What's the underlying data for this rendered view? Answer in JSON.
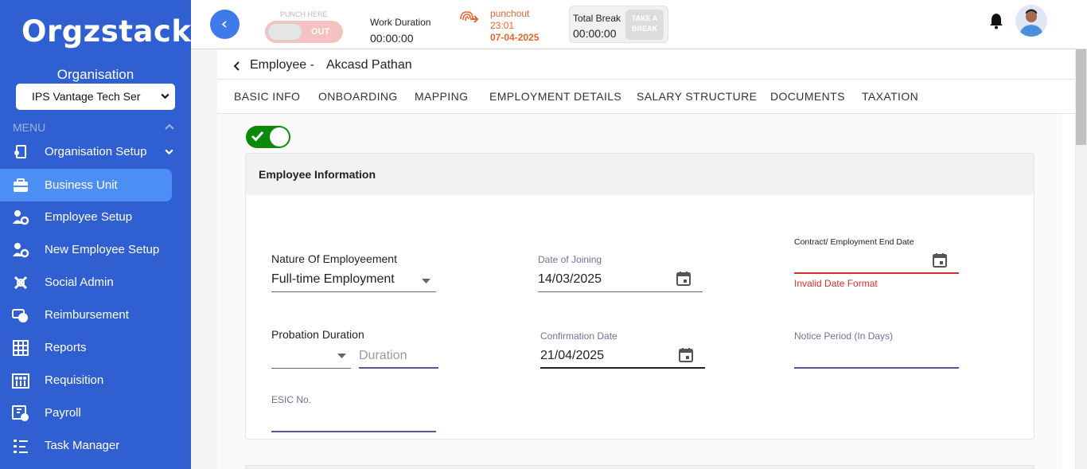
{
  "app": {
    "logo": "Orgzstack"
  },
  "sidebar": {
    "org_label": "Organisation",
    "org_select_value": "IPS Vantage Tech Ser",
    "menu_label": "MENU",
    "items": [
      {
        "label": "Organisation Setup",
        "icon": "org-setup-icon"
      },
      {
        "label": "Business Unit",
        "icon": "briefcase-icon"
      },
      {
        "label": "Employee Setup",
        "icon": "users-gear-icon"
      },
      {
        "label": "New Employee Setup",
        "icon": "users-gear-icon"
      },
      {
        "label": "Social Admin",
        "icon": "social-icon"
      },
      {
        "label": "Reimbursement",
        "icon": "money-icon"
      },
      {
        "label": "Reports",
        "icon": "grid-icon"
      },
      {
        "label": "Requisition",
        "icon": "people-icon"
      },
      {
        "label": "Payroll",
        "icon": "payroll-icon"
      },
      {
        "label": "Task Manager",
        "icon": "list-icon"
      }
    ]
  },
  "topbar": {
    "punch_here": "PUNCH HERE",
    "punch_toggle_label": "OUT",
    "work_duration_label": "Work Duration",
    "work_duration_value": "00:00:00",
    "punchout_label": "punchout",
    "punchout_time": "23:01",
    "punchout_date": "07-04-2025",
    "total_break_label": "Total Break",
    "total_break_value": "00:00:00",
    "take_break_label": "TAKE A BREAK"
  },
  "breadcrumb": {
    "title": "Employee -",
    "name": "Akcasd Pathan"
  },
  "tabs": [
    "BASIC INFO",
    "ONBOARDING",
    "MAPPING",
    "EMPLOYMENT DETAILS",
    "SALARY STRUCTURE",
    "DOCUMENTS",
    "TAXATION"
  ],
  "status_toggle_on": true,
  "card": {
    "title": "Employee Information",
    "nature_label": "Nature Of Employeement",
    "nature_value": "Full-time Employment",
    "doj_label": "Date of Joining",
    "doj_value": "14/03/2025",
    "end_date_label": "Contract/ Employment End Date",
    "end_date_error": "Invalid Date Format",
    "probation_label": "Probation Duration",
    "probation_placeholder": "Duration",
    "confirmation_label": "Confirmation Date",
    "confirmation_value": "21/04/2025",
    "notice_label": "Notice Period (In Days)",
    "esic_label": "ESIC No."
  },
  "colors": {
    "sidebar": "#2f5fd0",
    "active": "#4d8ef5",
    "punch": "#e8642d",
    "toggle_on": "#0b8a0b",
    "error": "#d93025"
  }
}
